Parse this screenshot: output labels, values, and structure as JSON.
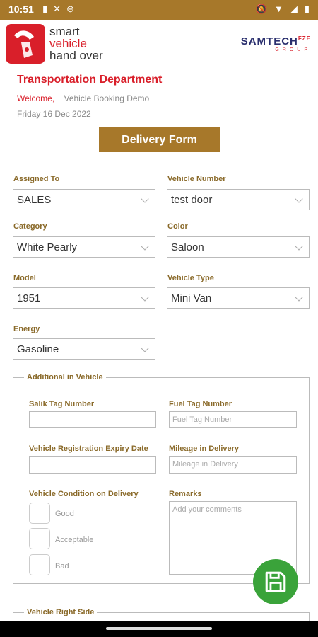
{
  "status_bar": {
    "time": "10:51"
  },
  "header": {
    "logo_line1": "smart",
    "logo_line2": "vehicle",
    "logo_line3": "hand over",
    "partner": "SAMTECH",
    "partner_sup": "FZE",
    "partner_group": "GROUP"
  },
  "page": {
    "department": "Transportation Department",
    "welcome": "Welcome,",
    "user": "Vehicle Booking Demo",
    "date": "Friday 16 Dec 2022",
    "form_button": "Delivery Form"
  },
  "fields": {
    "assigned_to": {
      "label": "Assigned To",
      "value": "SALES"
    },
    "vehicle_number": {
      "label": "Vehicle Number",
      "value": "test door"
    },
    "category": {
      "label": "Category",
      "value": "White Pearly"
    },
    "color": {
      "label": "Color",
      "value": "Saloon"
    },
    "model": {
      "label": "Model",
      "value": "1951"
    },
    "vehicle_type": {
      "label": "Vehicle Type",
      "value": "Mini Van"
    },
    "energy": {
      "label": "Energy",
      "value": "Gasoline"
    }
  },
  "additional": {
    "legend": "Additional in Vehicle",
    "salik_label": "Salik Tag Number",
    "fuel_label": "Fuel Tag Number",
    "fuel_placeholder": "Fuel Tag Number",
    "reg_label": "Vehicle Registration Expiry Date",
    "mileage_label": "Mileage in Delivery",
    "mileage_placeholder": "Mileage in Delivery",
    "condition_label": "Vehicle Condition on Delivery",
    "conditions": [
      "Good",
      "Acceptable",
      "Bad"
    ],
    "remarks_label": "Remarks",
    "remarks_placeholder": "Add your comments"
  },
  "right_side": {
    "legend": "Vehicle Right Side"
  }
}
